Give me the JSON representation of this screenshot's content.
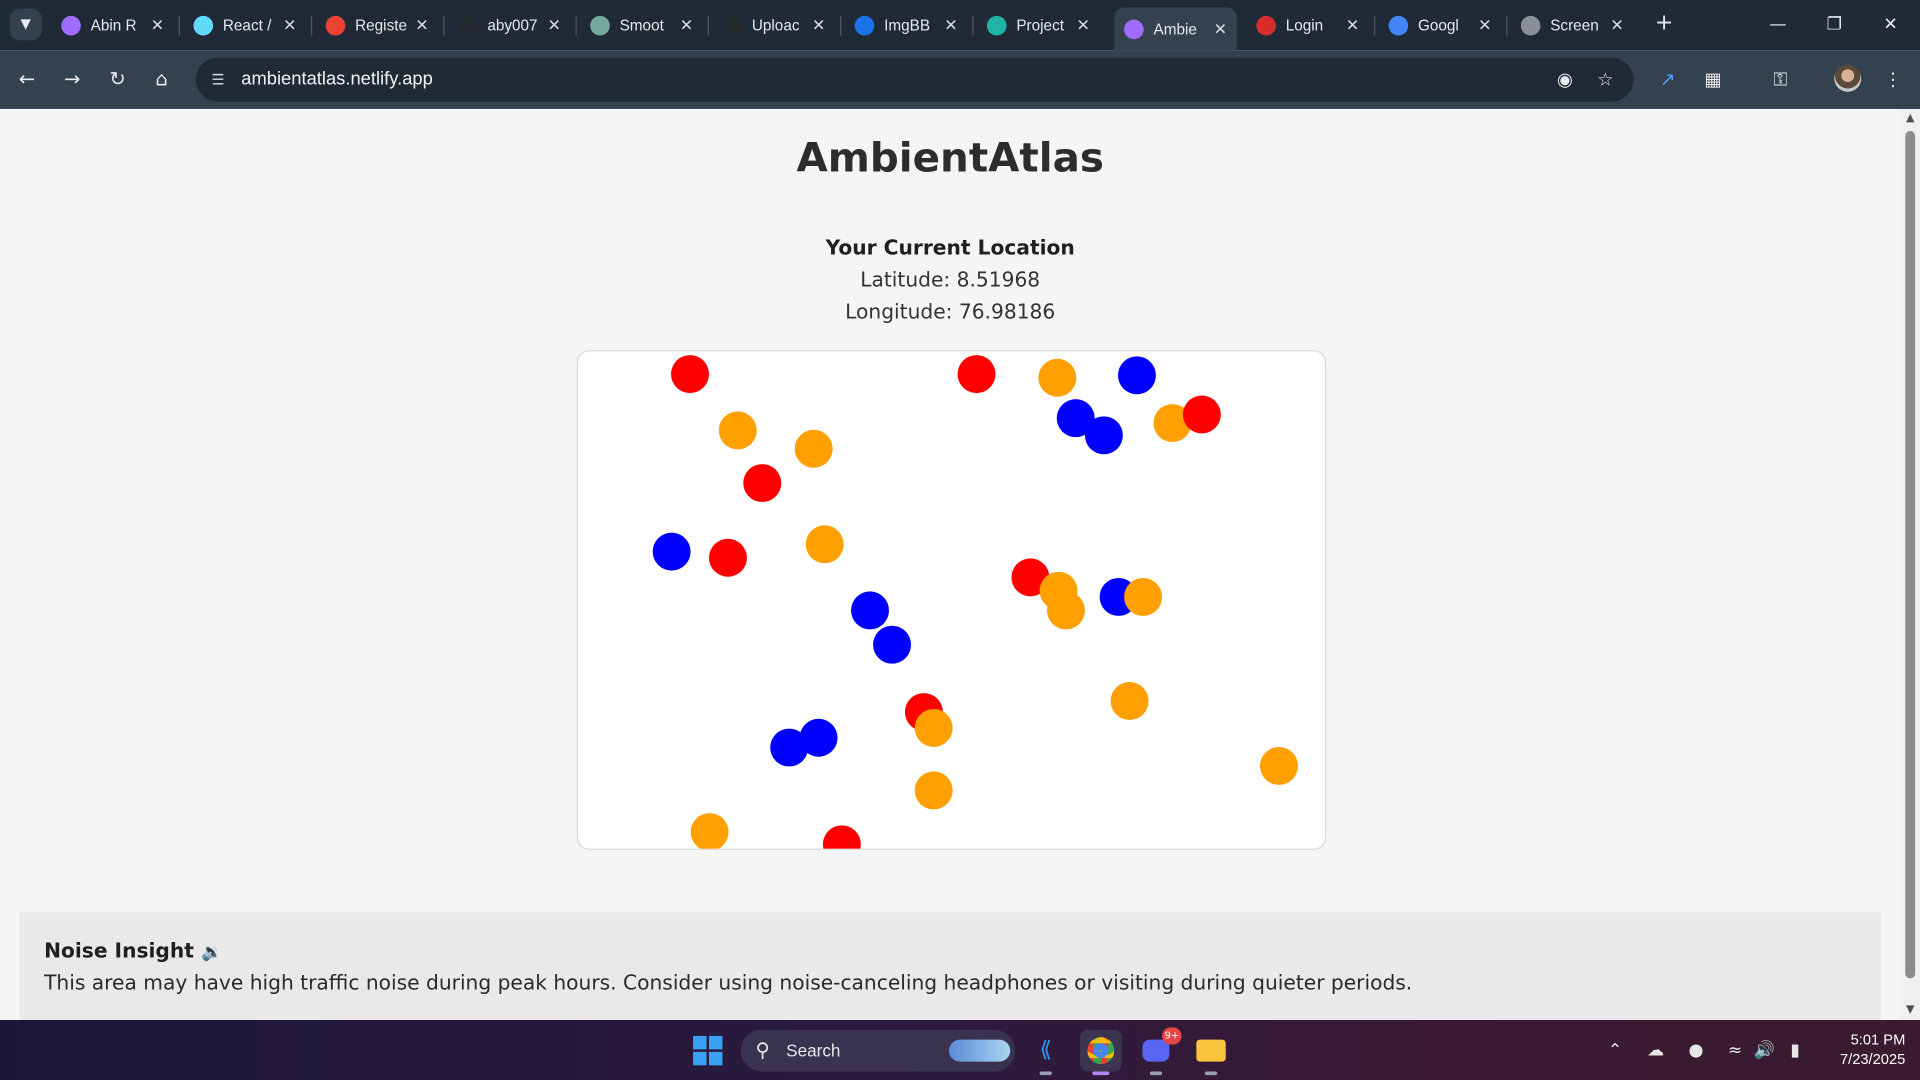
{
  "browser": {
    "tabs": [
      {
        "title": "Abin R",
        "icon": "vite-icon",
        "active": false
      },
      {
        "title": "React /",
        "icon": "react-icon",
        "active": false
      },
      {
        "title": "Registe",
        "icon": "gmail-icon",
        "active": false
      },
      {
        "title": "aby007",
        "icon": "github-icon",
        "active": false
      },
      {
        "title": "Smoot",
        "icon": "openai-icon",
        "active": false
      },
      {
        "title": "Uploac",
        "icon": "github-icon",
        "active": false
      },
      {
        "title": "ImgBB",
        "icon": "imgbb-icon",
        "active": false
      },
      {
        "title": "Project",
        "icon": "diamond-icon",
        "active": false
      },
      {
        "title": "Ambie",
        "icon": "vite-icon",
        "active": true
      },
      {
        "title": "Login",
        "icon": "mail-icon",
        "active": false
      },
      {
        "title": "Googl",
        "icon": "google-lens-icon",
        "active": false
      },
      {
        "title": "Screen",
        "icon": "globe-icon",
        "active": false
      }
    ],
    "url": "ambientatlas.netlify.app"
  },
  "page": {
    "title": "AmbientAtlas",
    "location_heading": "Your Current Location",
    "latitude_text": "Latitude: 8.51968",
    "longitude_text": "Longitude: 76.98186"
  },
  "map_legend_colors": {
    "red": "#ff0000",
    "orange": "#ffa000",
    "blue": "#0000ff"
  },
  "map_dots": [
    {
      "color": "red"
    },
    {
      "color": "red"
    },
    {
      "color": "orange"
    },
    {
      "color": "blue"
    },
    {
      "color": "blue"
    },
    {
      "color": "blue"
    },
    {
      "color": "orange"
    },
    {
      "color": "red"
    },
    {
      "color": "orange"
    },
    {
      "color": "orange"
    },
    {
      "color": "red"
    },
    {
      "color": "blue"
    },
    {
      "color": "red"
    },
    {
      "color": "orange"
    },
    {
      "color": "red"
    },
    {
      "color": "orange"
    },
    {
      "color": "orange"
    },
    {
      "color": "blue"
    },
    {
      "color": "orange"
    },
    {
      "color": "blue"
    },
    {
      "color": "blue"
    },
    {
      "color": "red"
    },
    {
      "color": "orange"
    },
    {
      "color": "orange"
    },
    {
      "color": "blue"
    },
    {
      "color": "blue"
    },
    {
      "color": "orange"
    },
    {
      "color": "orange"
    },
    {
      "color": "orange"
    },
    {
      "color": "red"
    }
  ],
  "insight": {
    "heading": "Noise Insight",
    "icon": "speaker-icon",
    "text": "This area may have high traffic noise during peak hours. Consider using noise-canceling headphones or visiting during quieter periods."
  },
  "taskbar": {
    "search_label": "Search",
    "discord_badge": "9+",
    "time": "5:01 PM",
    "date": "7/23/2025"
  }
}
